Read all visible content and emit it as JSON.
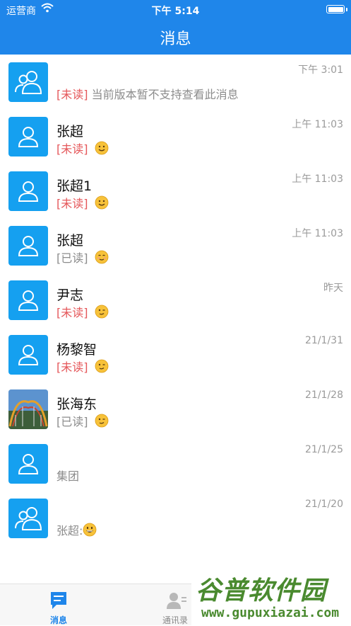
{
  "status_bar": {
    "carrier": "运营商",
    "time": "下午 5:14"
  },
  "nav": {
    "title": "消息"
  },
  "conversations": [
    {
      "name": "",
      "tag": "[未读]",
      "message": "当前版本暂不支持查看此消息",
      "time": "下午 3:01",
      "avatar": "group-avatar-icon",
      "tag_style": "unread"
    },
    {
      "name": "张超",
      "tag": "[未读]",
      "message": "",
      "time": "上午 11:03",
      "avatar": "person-avatar-icon",
      "tag_style": "unread",
      "emoji": "smile"
    },
    {
      "name": "张超1",
      "tag": "[未读]",
      "message": "",
      "time": "上午 11:03",
      "avatar": "person-avatar-icon",
      "tag_style": "unread",
      "emoji": "smile"
    },
    {
      "name": "张超",
      "tag": "[已读]",
      "message": "",
      "time": "上午 11:03",
      "avatar": "person-avatar-icon",
      "tag_style": "read",
      "emoji": "blush"
    },
    {
      "name": "尹志",
      "tag": "[未读]",
      "message": "",
      "time": "昨天",
      "avatar": "person-avatar-icon",
      "tag_style": "unread",
      "emoji": "wink"
    },
    {
      "name": "杨黎智",
      "tag": "[未读]",
      "message": "",
      "time": "21/1/31",
      "avatar": "person-avatar-icon",
      "tag_style": "unread",
      "emoji": "wink"
    },
    {
      "name": "张海东",
      "tag": "[已读]",
      "message": "",
      "time": "21/1/28",
      "avatar": "photo-avatar",
      "tag_style": "read",
      "emoji": "wink"
    },
    {
      "name": "",
      "tag": "",
      "message": "集团",
      "time": "21/1/25",
      "avatar": "person-avatar-icon",
      "tag_style": "read"
    },
    {
      "name": "",
      "tag": "",
      "message": "张超:",
      "time": "21/1/20",
      "avatar": "group-avatar-icon",
      "tag_style": "read",
      "emoji": "grin"
    }
  ],
  "tabs": [
    {
      "label": "消息",
      "icon": "chat-bubble-icon",
      "active": true
    },
    {
      "label": "通讯录",
      "icon": "contacts-icon",
      "active": false
    }
  ],
  "watermark": {
    "line1": "谷普软件园",
    "line2": "www.gupuxiazai.com"
  },
  "colors": {
    "brand_blue": "#1f86ea",
    "avatar_blue": "#15a0f0",
    "unread_red": "#e5575a"
  }
}
